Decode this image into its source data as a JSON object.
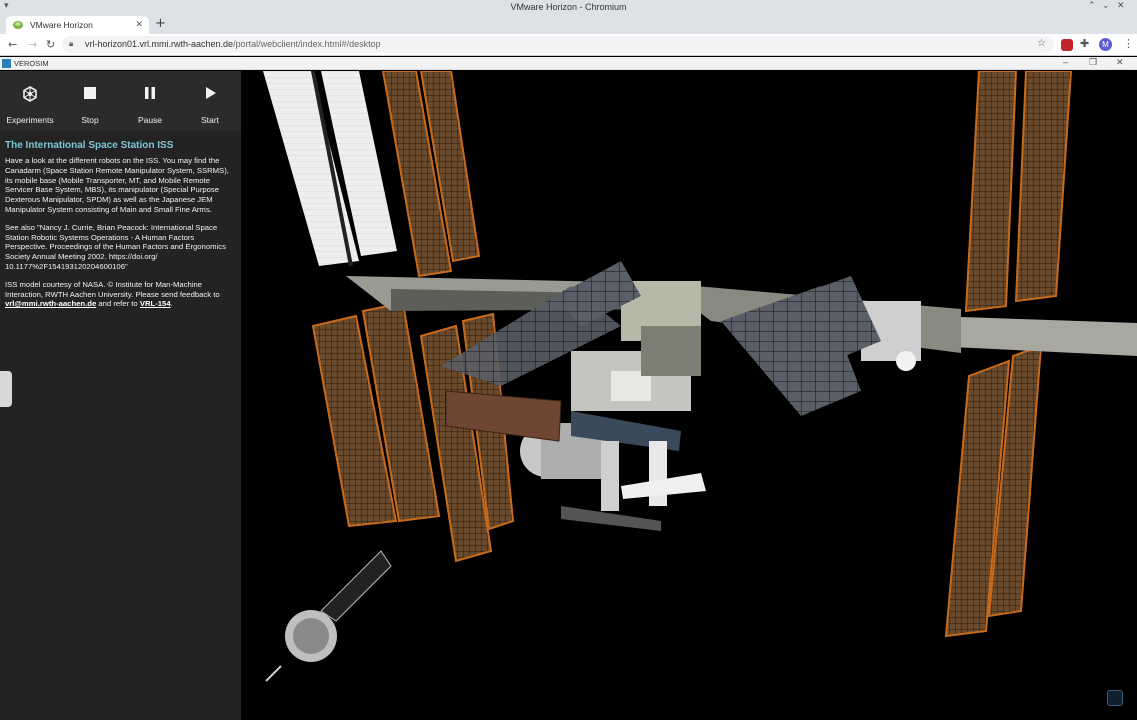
{
  "window": {
    "title": "VMware Horizon - Chromium"
  },
  "browser": {
    "tab_title": "VMware Horizon",
    "url_host": "vrl-horizon01.vrl.mmi.rwth-aachen.de",
    "url_path": "/portal/webclient/index.html#/desktop",
    "profile_initial": "M"
  },
  "session": {
    "app_name": "VEROSIM"
  },
  "controls": [
    {
      "label": "Experiments",
      "icon": "experiments-icon"
    },
    {
      "label": "Stop",
      "icon": "stop-icon"
    },
    {
      "label": "Pause",
      "icon": "pause-icon"
    },
    {
      "label": "Start",
      "icon": "start-icon"
    }
  ],
  "description": {
    "title": "The International Space Station ISS",
    "para1": "Have a look at the different robots on the ISS. You may find the Canadarm (Space Station Remote Manipulator System, SSRMS), its mobile base (Mobile Transporter, MT, and Mobile Remote Servicer Base System, MBS), its manipulator (Special Purpose Dexterous Manipulator, SPDM) as well as the Japanese JEM Manipulator System consisting of Main and Small Fine Arms.",
    "para2": "See also \"Nancy J. Currie, Brian Peacock: International Space Station Robotic Systems Operations - A Human Factors Perspective. Proceedings of the Human Factors and Ergonomics Society Annual Meeting 2002. https://doi.org/ 10.1177%2F154193120204600106\"",
    "para3_prefix": "ISS model courtesy of NASA. © Institute for Man-Machine Interaction, RWTH Aachen University. Please send feedback to",
    "email": "vrl@mmi.rwth-aachen.de",
    "para3_mid": "and refer to",
    "ref": "VRL-154",
    "para3_suffix": "."
  },
  "colors": {
    "panel_bg": "#232323",
    "title_accent": "#7fc6d8",
    "solar_orange": "#c86a1c",
    "solar_white": "#f0f0f0"
  }
}
